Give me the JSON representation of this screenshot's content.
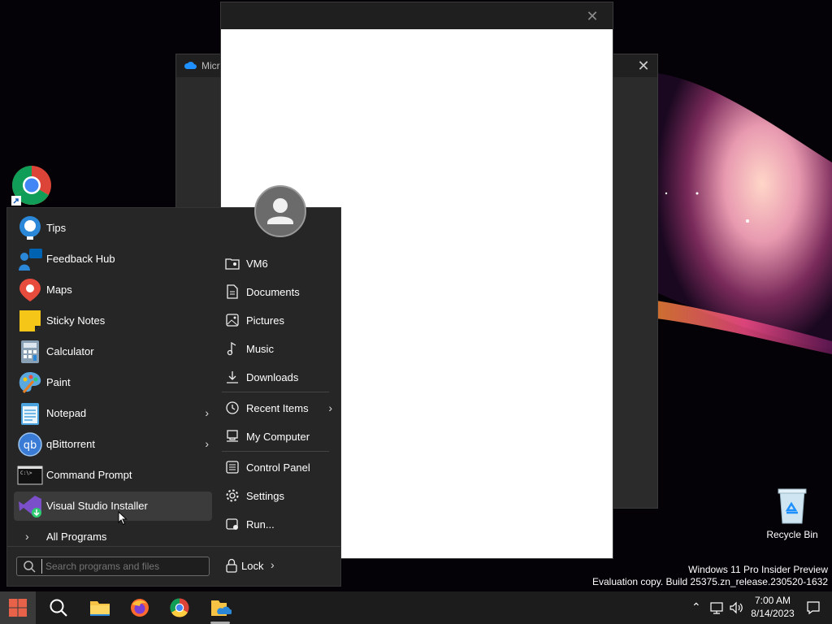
{
  "background_window": {
    "title": "Micro",
    "close_label": "✕"
  },
  "front_window": {
    "close_label": "✕"
  },
  "desktop": {
    "chrome_icon": "chrome-shortcut-icon",
    "recycle_bin_label": "Recycle Bin"
  },
  "start_menu": {
    "apps": [
      {
        "label": "Tips",
        "icon": "tips-icon",
        "has_submenu": false
      },
      {
        "label": "Feedback Hub",
        "icon": "feedback-hub-icon",
        "has_submenu": false
      },
      {
        "label": "Maps",
        "icon": "maps-icon",
        "has_submenu": false
      },
      {
        "label": "Sticky Notes",
        "icon": "sticky-notes-icon",
        "has_submenu": false
      },
      {
        "label": "Calculator",
        "icon": "calculator-icon",
        "has_submenu": false
      },
      {
        "label": "Paint",
        "icon": "paint-icon",
        "has_submenu": false
      },
      {
        "label": "Notepad",
        "icon": "notepad-icon",
        "has_submenu": true
      },
      {
        "label": "qBittorrent",
        "icon": "qbittorrent-icon",
        "has_submenu": true
      },
      {
        "label": "Command Prompt",
        "icon": "command-prompt-icon",
        "has_submenu": false
      },
      {
        "label": "Visual Studio Installer",
        "icon": "visual-studio-installer-icon",
        "has_submenu": false
      }
    ],
    "all_programs_label": "All Programs",
    "search_placeholder": "Search programs and files",
    "places": [
      {
        "label": "VM6"
      },
      {
        "label": "Documents"
      },
      {
        "label": "Pictures"
      },
      {
        "label": "Music"
      },
      {
        "label": "Downloads"
      },
      {
        "label": "Recent Items"
      },
      {
        "label": "My Computer"
      },
      {
        "label": "Control Panel"
      },
      {
        "label": "Settings"
      },
      {
        "label": "Run..."
      }
    ],
    "lock_label": "Lock"
  },
  "watermark": {
    "line1": "Windows 11 Pro Insider Preview",
    "line2": "Evaluation copy. Build 25375.zn_release.230520-1632"
  },
  "taskbar": {
    "time": "7:00 AM",
    "date": "8/14/2023",
    "accent": "#e8624a"
  }
}
